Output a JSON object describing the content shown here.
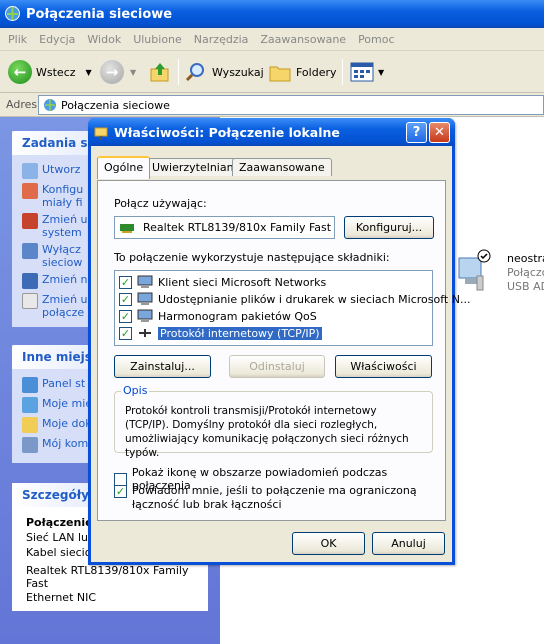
{
  "window": {
    "title": "Połączenia sieciowe"
  },
  "menu": [
    "Plik",
    "Edycja",
    "Widok",
    "Ulubione",
    "Narzędzia",
    "Zaawansowane",
    "Pomoc"
  ],
  "toolbar": {
    "back_label": "Wstecz",
    "search_label": "Wyszukaj",
    "folders_label": "Foldery"
  },
  "address": {
    "label": "Adres",
    "value": "Połączenia sieciowe"
  },
  "left": {
    "tasks_title": "Zadania sie",
    "tasks": [
      "Utworz",
      "Konfigu",
      "miały fi",
      "Zmień u",
      "system",
      "Wyłącz",
      "sieciow",
      "Zmień n",
      "Zmień u",
      "połącze"
    ],
    "other_title": "Inne miejsc",
    "other": [
      "Panel st",
      "Moje mie",
      "Moje dok",
      "Mój kom"
    ],
    "details_title": "Szczegóły",
    "details": [
      "Połączenie",
      "Sieć LAN lub",
      "Kabel sieciowy odłączony",
      "Realtek RTL8139/810x Family Fast",
      "Ethernet NIC"
    ]
  },
  "content": {
    "item_name": "neostra",
    "item_type": "Połączo",
    "item_status": "USB AD"
  },
  "dialog": {
    "title": "Właściwości: Połączenie lokalne",
    "help_btn": "?",
    "close_btn": "✕",
    "tabs": [
      "Ogólne",
      "Uwierzytelnianie",
      "Zaawansowane"
    ],
    "connect_using_label": "Połącz używając:",
    "adapter": "Realtek RTL8139/810x Family Fast",
    "configure_btn": "Konfiguruj...",
    "components_label": "To połączenie wykorzystuje następujące składniki:",
    "components": [
      {
        "label": "Klient sieci Microsoft Networks",
        "checked": true
      },
      {
        "label": "Udostępnianie plików i drukarek w sieciach Microsoft N...",
        "checked": true
      },
      {
        "label": "Harmonogram pakietów QoS",
        "checked": true
      },
      {
        "label": "Protokół internetowy (TCP/IP)",
        "checked": true
      }
    ],
    "install_btn": "Zainstaluj...",
    "uninstall_btn": "Odinstaluj",
    "properties_btn": "Właściwości",
    "description_title": "Opis",
    "description": "Protokół kontroli transmisji/Protokół internetowy (TCP/IP). Domyślny protokół dla sieci rozległych, umożliwiający komunikację połączonych sieci różnych typów.",
    "show_icon_label": "Pokaż ikonę w obszarze powiadomień podczas połączenia",
    "show_icon_checked": false,
    "notify_label": "Powiadom mnie, jeśli to połączenie ma ograniczoną łączność lub brak łączności",
    "notify_checked": true,
    "ok_btn": "OK",
    "cancel_btn": "Anuluj"
  }
}
